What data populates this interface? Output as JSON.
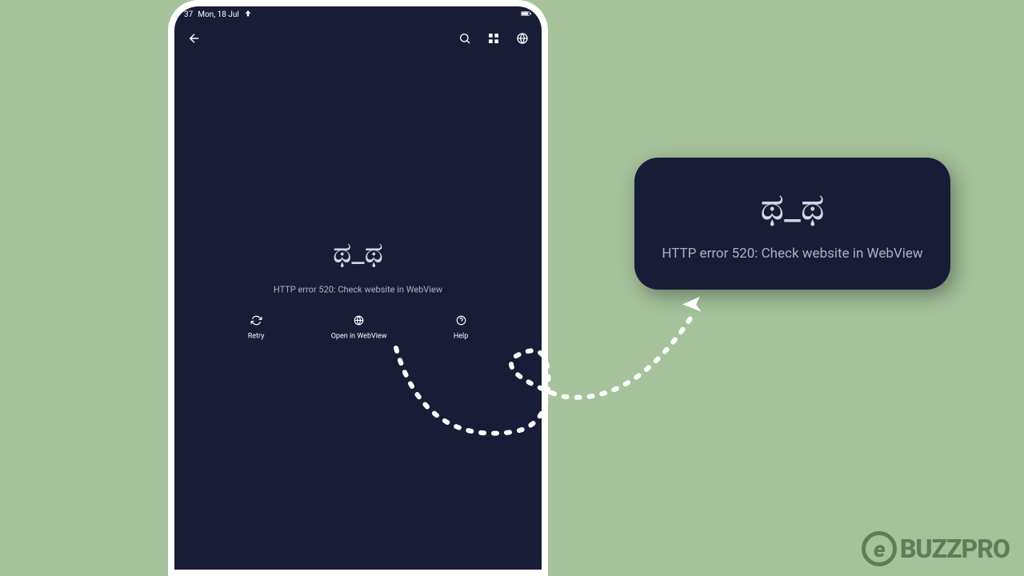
{
  "statusBar": {
    "time": "37",
    "date": "Mon, 18 Jul"
  },
  "errorScreen": {
    "emoji": "ಥ_ಥ",
    "message": "HTTP error 520: Check website in WebView",
    "actions": {
      "retry": "Retry",
      "openWebView": "Open in WebView",
      "help": "Help"
    }
  },
  "callout": {
    "emoji": "ಥ_ಥ",
    "message": "HTTP error 520: Check website in WebView"
  },
  "watermark": {
    "iconLetter": "e",
    "text": "BUZZPRO"
  }
}
